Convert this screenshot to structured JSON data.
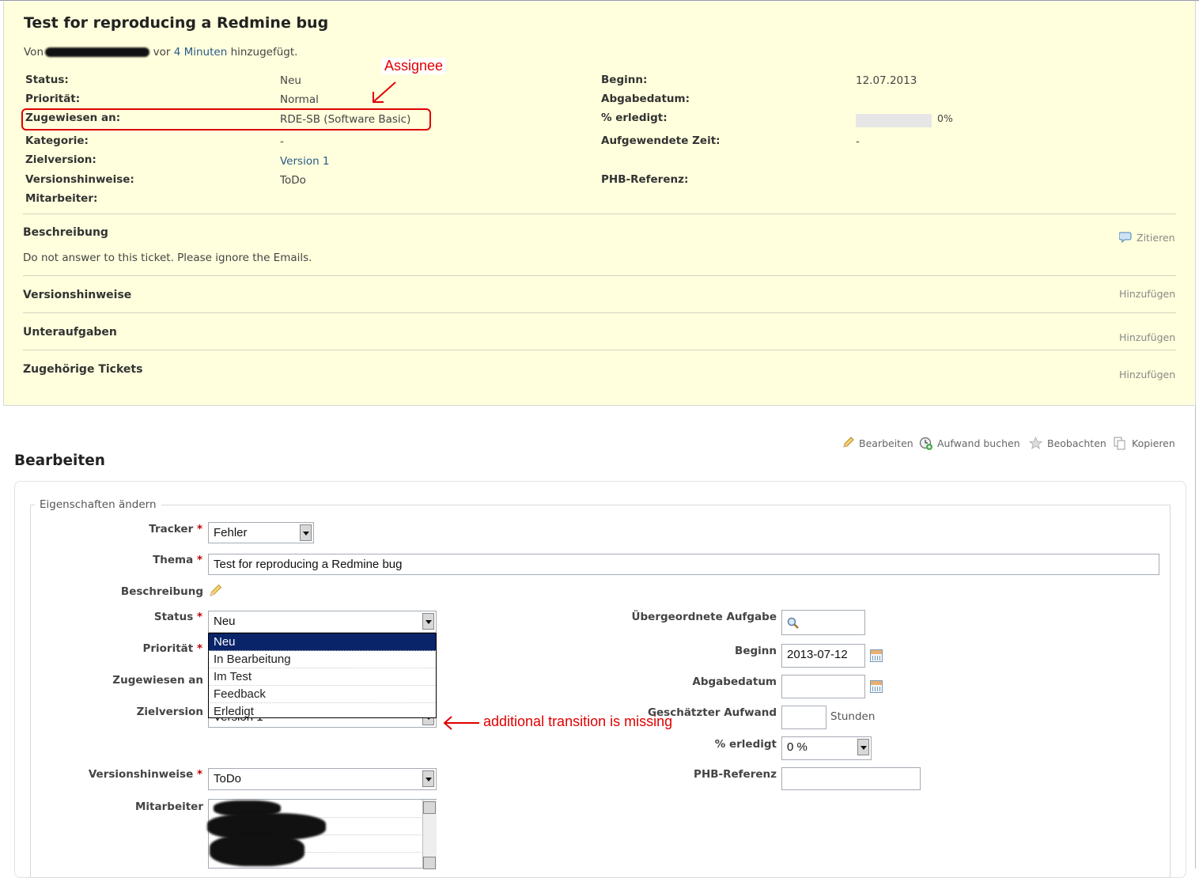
{
  "issue": {
    "title": "Test for reproducing a Redmine bug",
    "author_prefix": "Von",
    "added_time": "4 Minuten",
    "added_suffix": "hinzugefügt.",
    "added_connector": "vor",
    "fields_left": [
      {
        "label": "Status:",
        "value": "Neu"
      },
      {
        "label": "Priorität:",
        "value": "Normal"
      },
      {
        "label": "Zugewiesen an:",
        "value": "RDE-SB (Software Basic)"
      },
      {
        "label": "Kategorie:",
        "value": "-"
      },
      {
        "label": "Zielversion:",
        "value": "Version 1"
      },
      {
        "label": "Versionshinweise:",
        "value": "ToDo"
      },
      {
        "label": "Mitarbeiter:",
        "value": ""
      }
    ],
    "fields_right": [
      {
        "label": "Beginn:",
        "value": "12.07.2013"
      },
      {
        "label": "Abgabedatum:",
        "value": ""
      },
      {
        "label": "% erledigt:",
        "value": "0%"
      },
      {
        "label": "Aufgewendete Zeit:",
        "value": "-"
      },
      {
        "label": "PHB-Referenz:",
        "value": ""
      }
    ],
    "done_ratio": 0,
    "description_heading": "Beschreibung",
    "quote_link": "Zitieren",
    "description_text": "Do not answer to this ticket. Please ignore the Emails.",
    "sections": [
      {
        "title": "Versionshinweise",
        "action": "Hinzufügen"
      },
      {
        "title": "Unteraufgaben",
        "action": "Hinzufügen"
      },
      {
        "title": "Zugehörige Tickets",
        "action": "Hinzufügen"
      }
    ]
  },
  "annotations": {
    "assignee": "Assignee",
    "missing": "additional transition is missing"
  },
  "actions": {
    "edit": "Bearbeiten",
    "log_time": "Aufwand buchen",
    "watch": "Beobachten",
    "copy": "Kopieren"
  },
  "edit": {
    "heading": "Bearbeiten",
    "legend": "Eigenschaften ändern",
    "tracker_label": "Tracker",
    "tracker_value": "Fehler",
    "subject_label": "Thema",
    "subject_value": "Test for reproducing a Redmine bug",
    "description_label": "Beschreibung",
    "status_label": "Status",
    "status_value": "Neu",
    "status_options": [
      "Neu",
      "In Bearbeitung",
      "Im Test",
      "Feedback",
      "Erledigt"
    ],
    "priority_label": "Priorität",
    "assignee_label": "Zugewiesen an",
    "target_version_label": "Zielversion",
    "target_version_value": "Version 1",
    "release_notes_label": "Versionshinweise",
    "release_notes_value": "ToDo",
    "watchers_label": "Mitarbeiter",
    "parent_label": "Übergeordnete Aufgabe",
    "start_label": "Beginn",
    "start_value": "2013-07-12",
    "due_label": "Abgabedatum",
    "estimated_label": "Geschätzter Aufwand",
    "hours_unit": "Stunden",
    "done_label": "% erledigt",
    "done_value": "0 %",
    "phb_label": "PHB-Referenz"
  },
  "colors": {
    "issue_bg": "#ffffdd",
    "link": "#2a5a8a",
    "annotation": "#e00000",
    "selected_option": "#0a246a"
  }
}
